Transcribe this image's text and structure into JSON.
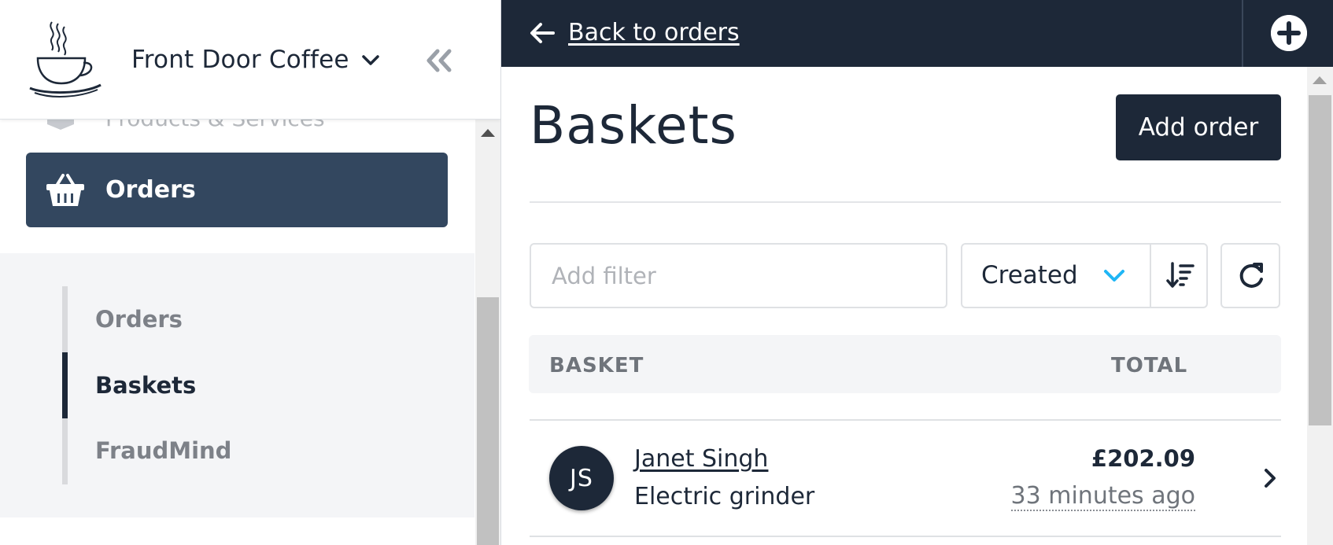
{
  "colors": {
    "navy": "#1d2838",
    "sidebar_active": "#33475f",
    "accent": "#1fb6f5",
    "muted_text": "#6f747b",
    "sub_nav_bg": "#f4f5f7"
  },
  "sidebar": {
    "store_name": "Front Door Coffee",
    "logo_icon": "coffee-cup-logo",
    "store_switch_icon": "chevron-down-icon",
    "collapse_icon": "double-chevron-left-icon",
    "partial_item_label": "Products & Services",
    "partial_item_icon": "box-icon",
    "active_item": {
      "label": "Orders",
      "icon": "basket-icon"
    },
    "sub_items": [
      {
        "label": "Orders",
        "active": false
      },
      {
        "label": "Baskets",
        "active": true
      },
      {
        "label": "FraudMind",
        "active": false
      }
    ]
  },
  "topbar": {
    "back_label": "Back to orders",
    "back_icon": "arrow-left-icon",
    "add_icon": "plus-circle-icon"
  },
  "main": {
    "title": "Baskets",
    "add_order_label": "Add order",
    "filter_placeholder": "Add filter",
    "filter_value": "",
    "sort_field": "Created",
    "sort_icons": [
      "chevron-down-icon",
      "sort-descending-icon"
    ],
    "refresh_icon": "refresh-icon",
    "table": {
      "columns": [
        "BASKET",
        "TOTAL"
      ],
      "rows": [
        {
          "initials": "JS",
          "customer": "Janet Singh",
          "item": "Electric grinder",
          "amount": "£202.09",
          "time": "33 minutes ago"
        }
      ]
    }
  }
}
